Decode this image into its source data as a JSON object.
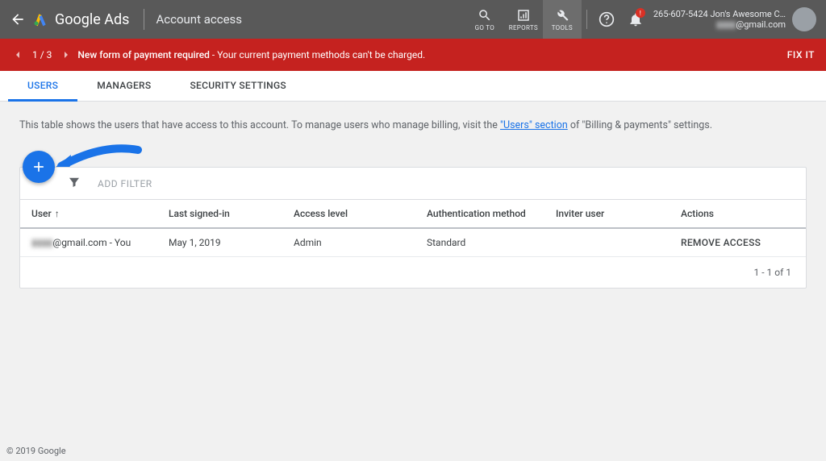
{
  "header": {
    "product": "Google Ads",
    "page_title": "Account access",
    "tools": {
      "goto": "GO TO",
      "reports": "REPORTS",
      "tools": "TOOLS"
    },
    "notif_badge": "!",
    "account_line1": "265-607-5424 Jon's Awesome C…",
    "account_line2": "@gmail.com"
  },
  "alert": {
    "counter": "1 / 3",
    "bold": "New form of payment required",
    "rest": " - Your current payment methods can't be charged.",
    "fix": "FIX IT"
  },
  "tabs": [
    {
      "label": "USERS",
      "active": true
    },
    {
      "label": "MANAGERS",
      "active": false
    },
    {
      "label": "SECURITY SETTINGS",
      "active": false
    }
  ],
  "intro": {
    "pre": "This table shows the users that have access to this account. To manage users who manage billing, visit the ",
    "link": "\"Users\" section",
    "post": " of \"Billing & payments\" settings."
  },
  "filter": {
    "add": "ADD FILTER"
  },
  "table": {
    "columns": [
      "User",
      "Last signed-in",
      "Access level",
      "Authentication method",
      "Inviter user",
      "Actions"
    ],
    "rows": [
      {
        "user_blur": "▮▮▮▮",
        "user_suffix": "@gmail.com - You",
        "last": "May 1, 2019",
        "access": "Admin",
        "auth": "Standard",
        "inviter": "",
        "action": "REMOVE ACCESS"
      }
    ],
    "pager": "1 - 1 of 1"
  },
  "footer": "© 2019 Google"
}
